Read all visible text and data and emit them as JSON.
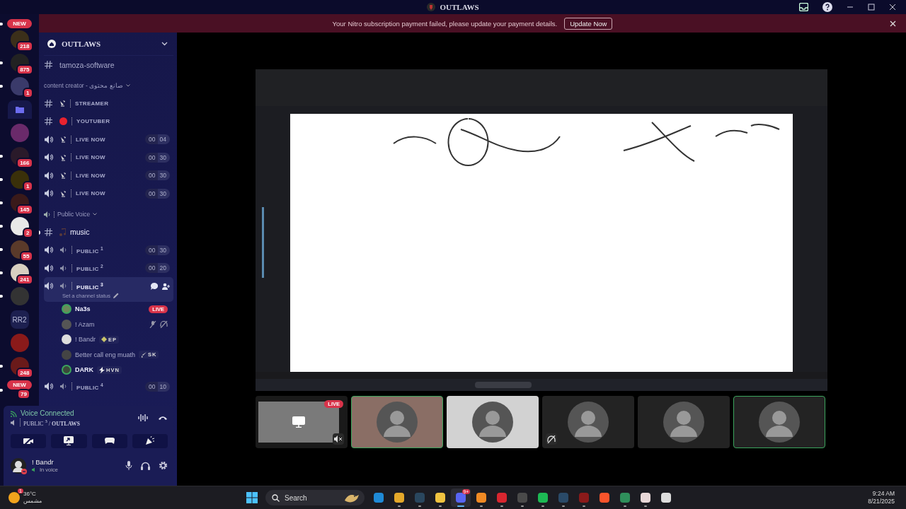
{
  "title_bar": {
    "title": "OUTLAWS"
  },
  "banner": {
    "message": "Your Nitro subscription payment failed, please update your payment details.",
    "button": "Update Now"
  },
  "servers": [
    {
      "kind": "new",
      "label": "NEW",
      "unread": true
    },
    {
      "kind": "server",
      "badge": "218",
      "unread": false
    },
    {
      "kind": "server",
      "badge": "875",
      "unread": true
    },
    {
      "kind": "server",
      "badge": "1",
      "unread": true
    },
    {
      "kind": "folder",
      "unread": false
    },
    {
      "kind": "server",
      "unread": false
    },
    {
      "kind": "server",
      "badge": "166",
      "unread": true
    },
    {
      "kind": "server",
      "badge": "1",
      "unread": true
    },
    {
      "kind": "server",
      "badge": "145",
      "unread": true
    },
    {
      "kind": "server",
      "badge": "2",
      "unread": true
    },
    {
      "kind": "server",
      "badge": "55",
      "unread": true
    },
    {
      "kind": "server",
      "badge": "241",
      "unread": true
    },
    {
      "kind": "server",
      "unread": true
    },
    {
      "kind": "text",
      "label": "RR2",
      "unread": false
    },
    {
      "kind": "server",
      "unread": false
    },
    {
      "kind": "server",
      "badge": "248",
      "unread": true
    },
    {
      "kind": "new",
      "label": "NEW",
      "badge": "79",
      "unread": true
    }
  ],
  "server_name": "OUTLAWS",
  "channels": [
    {
      "kind": "text",
      "name": "tamoza-software",
      "selected": false,
      "unread": false
    },
    {
      "kind": "category",
      "name": "content creator - صانع محتوى"
    },
    {
      "kind": "stream_text",
      "name": "STREAMER",
      "selected": false,
      "unread": false
    },
    {
      "kind": "record_text",
      "name": "YOUTUBER",
      "selected": false,
      "unread": false
    },
    {
      "kind": "stream_voice",
      "name": "LIVE NOW",
      "count": "00",
      "limit": "04",
      "selected": false
    },
    {
      "kind": "stream_voice",
      "name": "LIVE NOW",
      "count": "00",
      "limit": "30",
      "selected": false
    },
    {
      "kind": "stream_voice",
      "name": "LIVE NOW",
      "count": "00",
      "limit": "30",
      "selected": false
    },
    {
      "kind": "stream_voice",
      "name": "LIVE NOW",
      "count": "00",
      "limit": "30",
      "selected": false
    },
    {
      "kind": "voice_category",
      "name": "Public Voice"
    },
    {
      "kind": "music_text",
      "name": "music",
      "selected": false,
      "unread": true
    },
    {
      "kind": "voice",
      "name": "PUBLIC $^{1}$",
      "count": "00",
      "limit": "30",
      "selected": false
    },
    {
      "kind": "voice",
      "name": "PUBLIC $^{2}$",
      "count": "00",
      "limit": "20",
      "selected": false
    },
    {
      "kind": "voice",
      "name": "PUBLIC $^{3}$",
      "selected": true,
      "status_placeholder": "Set a channel status",
      "members": [
        {
          "name": "Na3s",
          "speaking": true,
          "live": "LIVE",
          "muted": false,
          "deafened": false
        },
        {
          "name": "! Azam",
          "speaking": false,
          "muted": true,
          "deafened": true
        },
        {
          "name": "! Bandr",
          "speaking": false,
          "tag": {
            "kind": "diamond",
            "label": "EP"
          },
          "muted": false,
          "deafened": false
        },
        {
          "name": "Better call eng muath",
          "speaking": false,
          "tag": {
            "kind": "sword",
            "label": "SK"
          },
          "muted": false,
          "deafened": false
        },
        {
          "name": "DARK",
          "speaking": true,
          "tag": {
            "kind": "bolt",
            "label": "HVN"
          },
          "muted": false,
          "deafened": false
        }
      ]
    },
    {
      "kind": "voice",
      "name": "PUBLIC $^{4}$",
      "count": "00",
      "limit": "10",
      "selected": false
    }
  ],
  "voice_panel": {
    "status": "Voice Connected",
    "channel": "PUBLIC $^{3}$ / **OUTLAWS**"
  },
  "user": {
    "name": "! Bandr",
    "status": "In voice"
  },
  "tiles": [
    {
      "kind": "screen",
      "live": "LIVE",
      "speaking": false,
      "muted": true,
      "deafened": false,
      "color": "#7a7a7a"
    },
    {
      "kind": "avatar",
      "speaking": true,
      "muted": false,
      "deafened": false,
      "color": "#8a6e65"
    },
    {
      "kind": "avatar",
      "speaking": false,
      "muted": false,
      "deafened": false,
      "color": "#d2d2d2"
    },
    {
      "kind": "avatar",
      "speaking": false,
      "muted": false,
      "deafened": true,
      "color": "#232323"
    },
    {
      "kind": "avatar",
      "speaking": false,
      "muted": false,
      "deafened": false,
      "color": "#232323"
    },
    {
      "kind": "avatar",
      "speaking": true,
      "muted": false,
      "deafened": false,
      "color": "#232323"
    }
  ],
  "taskbar": {
    "weather": {
      "temp": "36°C",
      "condition": "مشمس",
      "badge": "1"
    },
    "search": "Search",
    "apps": [
      {
        "color": "#1f8ad6",
        "running": false,
        "active": false
      },
      {
        "color": "#e4a82a",
        "running": true,
        "active": false
      },
      {
        "color": "#2a475e",
        "running": true,
        "active": false
      },
      {
        "color": "#f0c340",
        "running": true,
        "active": false
      },
      {
        "color": "#5865f2",
        "running": true,
        "active": true,
        "badge": "9+"
      },
      {
        "color": "#f08a24",
        "running": true,
        "active": false
      },
      {
        "color": "#d8262f",
        "running": true,
        "active": false
      },
      {
        "color": "#4a4a4a",
        "running": true,
        "active": false
      },
      {
        "color": "#1db954",
        "running": true,
        "active": false
      },
      {
        "color": "#2a4a68",
        "running": true,
        "active": false
      },
      {
        "color": "#8b1a1a",
        "running": true,
        "active": false
      },
      {
        "color": "#fb542b",
        "running": false,
        "active": false
      },
      {
        "color": "#2f8f5b",
        "running": true,
        "active": false
      },
      {
        "color": "#e8d8d8",
        "running": true,
        "active": false
      },
      {
        "color": "#dddddd",
        "running": false,
        "active": false
      }
    ],
    "time": "9:24 AM",
    "date": "8/21/2025"
  }
}
